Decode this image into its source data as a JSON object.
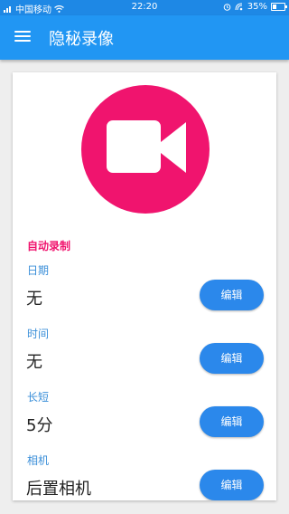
{
  "status_bar": {
    "carrier": "中国移动",
    "time": "22:20",
    "battery": "35%",
    "battery_level": 0.35,
    "icons": [
      "signal-icon",
      "wifi-icon",
      "alarm-icon",
      "nfc-icon",
      "battery-icon"
    ]
  },
  "app_bar": {
    "title": "隐秘录像",
    "menu_icon": "hamburger-menu-icon"
  },
  "colors": {
    "primary": "#2196f3",
    "status_bar": "#1e88e5",
    "accent": "#f0146e",
    "button": "#2b88eb",
    "label": "#3b8fd9"
  },
  "main": {
    "camera_icon": "video-camera-icon",
    "section_title": "自动录制",
    "fields": [
      {
        "label": "日期",
        "value": "无",
        "button": "编辑"
      },
      {
        "label": "时间",
        "value": "无",
        "button": "编辑"
      },
      {
        "label": "长短",
        "value": "5分",
        "button": "编辑"
      },
      {
        "label": "相机",
        "value": "后置相机",
        "button": "编辑"
      }
    ]
  }
}
